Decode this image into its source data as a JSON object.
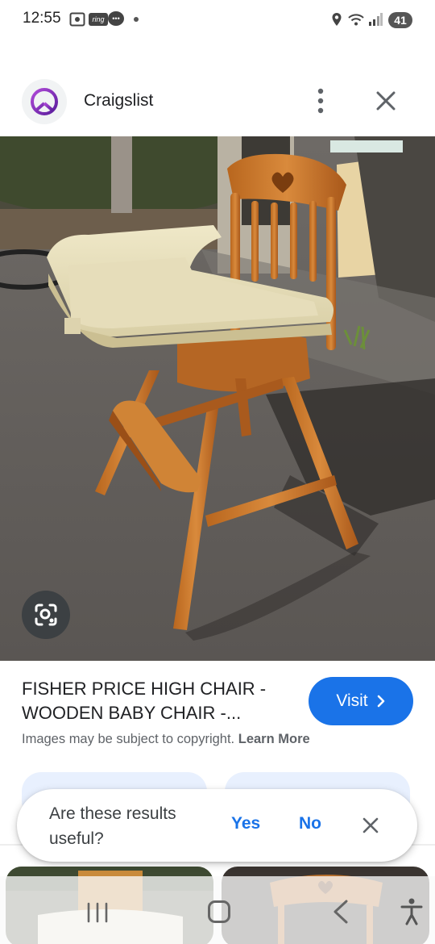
{
  "status_bar": {
    "time": "12:55",
    "ring_label": "ring",
    "battery": "41"
  },
  "header": {
    "site_name": "Craigslist",
    "logo_icon": "peace-sign-icon",
    "logo_color": "#7b2ab8"
  },
  "result": {
    "title": "FISHER PRICE HIGH CHAIR - WOODEN BABY CHAIR -...",
    "visit_label": "Visit",
    "copyright_text": "Images may be subject to copyright.",
    "learn_more": "Learn More"
  },
  "feedback": {
    "question": "Are these results useful?",
    "yes_label": "Yes",
    "no_label": "No"
  },
  "colors": {
    "accent": "#1a73e8",
    "chip_bg": "#e8f0fe"
  }
}
